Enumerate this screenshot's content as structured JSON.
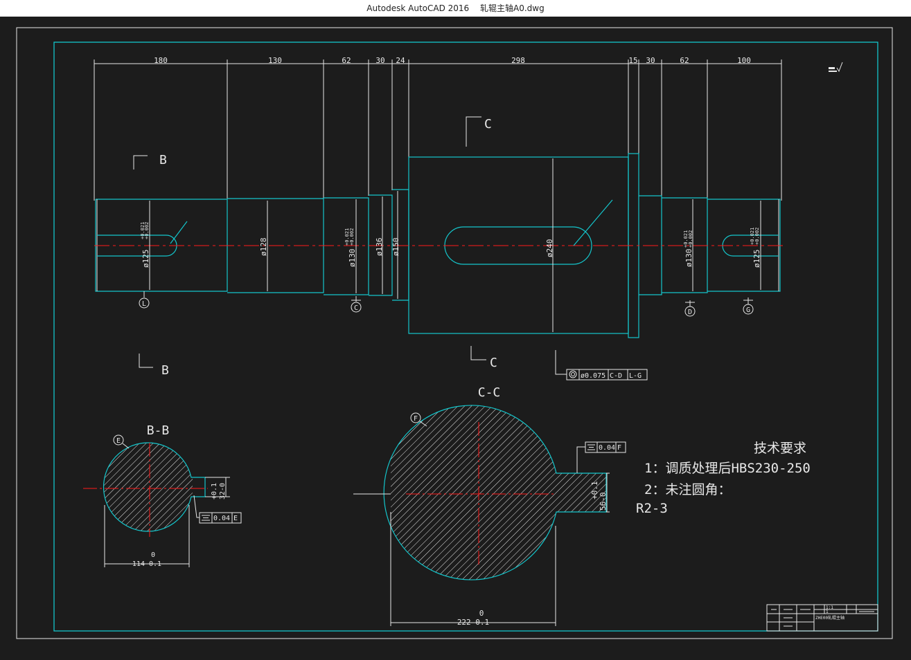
{
  "window": {
    "app_title": "Autodesk AutoCAD 2016",
    "file_name": "轧辊主轴A0.dwg"
  },
  "drawing": {
    "dims_top": [
      "180",
      "130",
      "62",
      "30",
      "24",
      "298",
      "15",
      "30",
      "62",
      "100"
    ],
    "diameters": {
      "d1": "ø125",
      "d1_tol_up": "+0.021",
      "d1_tol_lo": "+0.002",
      "d2": "ø128",
      "d3": "ø130",
      "d3_tol_up": "+0.021",
      "d3_tol_lo": "+0.002",
      "d4": "ø136",
      "d5": "ø150",
      "d6": "ø240",
      "d7": "ø130",
      "d7_tol_up": "+0.021",
      "d7_tol_lo": "+0.002",
      "d8": "ø125",
      "d8_tol_up": "+0.021",
      "d8_tol_lo": "+0.002"
    },
    "section_marks": {
      "b": "B",
      "c": "C"
    },
    "datums": {
      "L": "L",
      "C": "C",
      "D": "D",
      "G": "G",
      "E": "E",
      "F": "F"
    },
    "fcf_main": {
      "value": "ø0.075",
      "ref1": "C-D",
      "ref2": "L-G"
    },
    "section_bb": {
      "title": "B-B",
      "width_nominal": "0",
      "width_dim": "114-0.1",
      "depth_tol": "+0.1",
      "depth_nominal": "32-0",
      "fcf_value": "0.04",
      "fcf_ref": "E"
    },
    "section_cc": {
      "title": "C-C",
      "width_nominal": "0",
      "width_dim": "222-0.1",
      "depth_tol": "+0.1",
      "depth_nominal": "56-0",
      "fcf_value": "0.04",
      "fcf_ref": "F"
    },
    "tech_req": {
      "title": "技术要求",
      "line1": "1：调质处理后HBS230-250",
      "line2": "2：未注圆角：",
      "line3": "R2-3"
    },
    "title_block": {
      "part_name": "ZHE00轧辊主轴",
      "scale": "1:1",
      "sheet": "1"
    }
  }
}
